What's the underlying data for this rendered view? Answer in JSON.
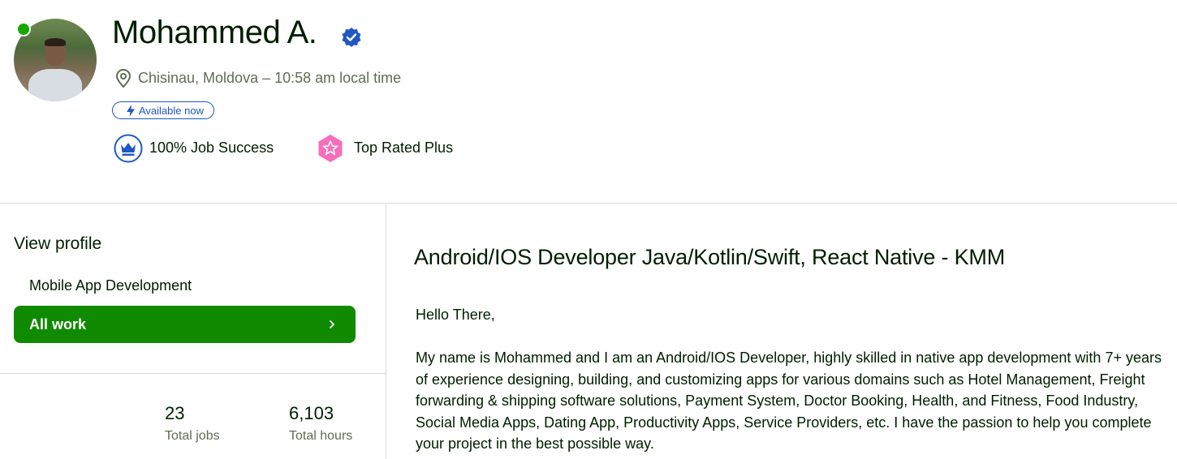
{
  "profile": {
    "name": "Mohammed A.",
    "location": "Chisinau, Moldova – 10:58 am local time",
    "availability": "Available now",
    "badges": [
      {
        "label": "100% Job Success",
        "icon": "crown-icon"
      },
      {
        "label": "Top Rated Plus",
        "icon": "star-badge-icon"
      }
    ]
  },
  "sidebar": {
    "view_profile": "View profile",
    "items": [
      {
        "label": "Mobile App Development"
      },
      {
        "label": "All work"
      }
    ],
    "stats": [
      {
        "value": "23",
        "label": "Total jobs"
      },
      {
        "value": "6,103",
        "label": "Total hours"
      }
    ]
  },
  "main": {
    "title": "Android/IOS Developer Java/Kotlin/Swift, React Native - KMM",
    "greeting": "Hello There,",
    "bio": "My name is Mohammed and I am an Android/IOS Developer, highly skilled in native app development with 7+ years of experience designing, building, and customizing apps for various domains such as Hotel Management, Freight forwarding & shipping software solutions, Payment System, Doctor Booking, Health, and Fitness, Food Industry, Social Media Apps, Dating App, Productivity Apps, Service Providers, etc. I have the passion to help you complete your project in the best possible way."
  },
  "colors": {
    "brand_green": "#108a00",
    "online_green": "#14a800",
    "verified_blue": "#1f57c3",
    "top_rated_pink": "#f66dbc",
    "text_primary": "#001e00",
    "text_secondary": "#5e6d55"
  }
}
